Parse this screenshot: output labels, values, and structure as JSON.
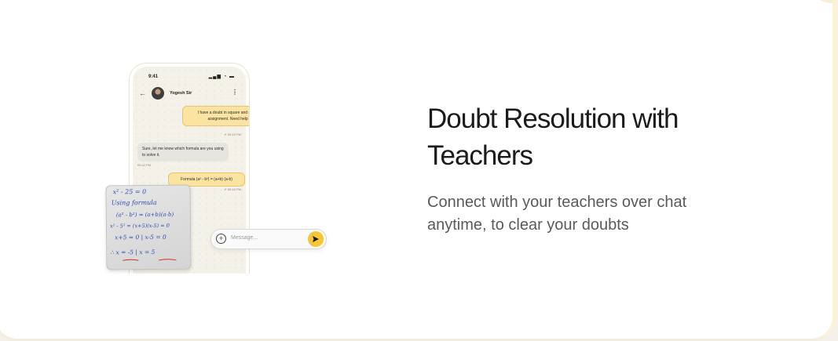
{
  "phone": {
    "status_time": "9:41",
    "status_icons": "▂▄▆ ◔ ▬",
    "contact_name": "Yogesh Sir",
    "messages": [
      {
        "from": "student",
        "text": "I have a doubt in square and square roots assignment. Need help in this.",
        "time": "05:40 PM"
      },
      {
        "from": "teacher",
        "text": "Sure, let me know which formula are you using to solve it.",
        "time": "05:42 PM"
      },
      {
        "from": "student",
        "text": "Formula (a² - b²) = (a+b) (a-b)",
        "time": "05:40 PM"
      }
    ],
    "input_placeholder": "Message..."
  },
  "note": {
    "lines": [
      "x² - 25 = 0",
      "Using formula",
      "(a² - b²) = (a+b)(a-b)",
      "x² - 5² = (x+5)(x-5) = 0",
      "x+5 = 0  |  x-5 = 0",
      "∴ x = -5  |  x = 5"
    ]
  },
  "feature": {
    "title_line1": "Doubt Resolution with",
    "title_line2": "Teachers",
    "description_line1": "Connect with your teachers over chat",
    "description_line2": "anytime, to clear your doubts"
  },
  "colors": {
    "accent": "#f7c539",
    "sent_bubble": "#fbe3a1",
    "received_bubble": "#e7e5df",
    "handwriting": "#2c4bb0"
  }
}
